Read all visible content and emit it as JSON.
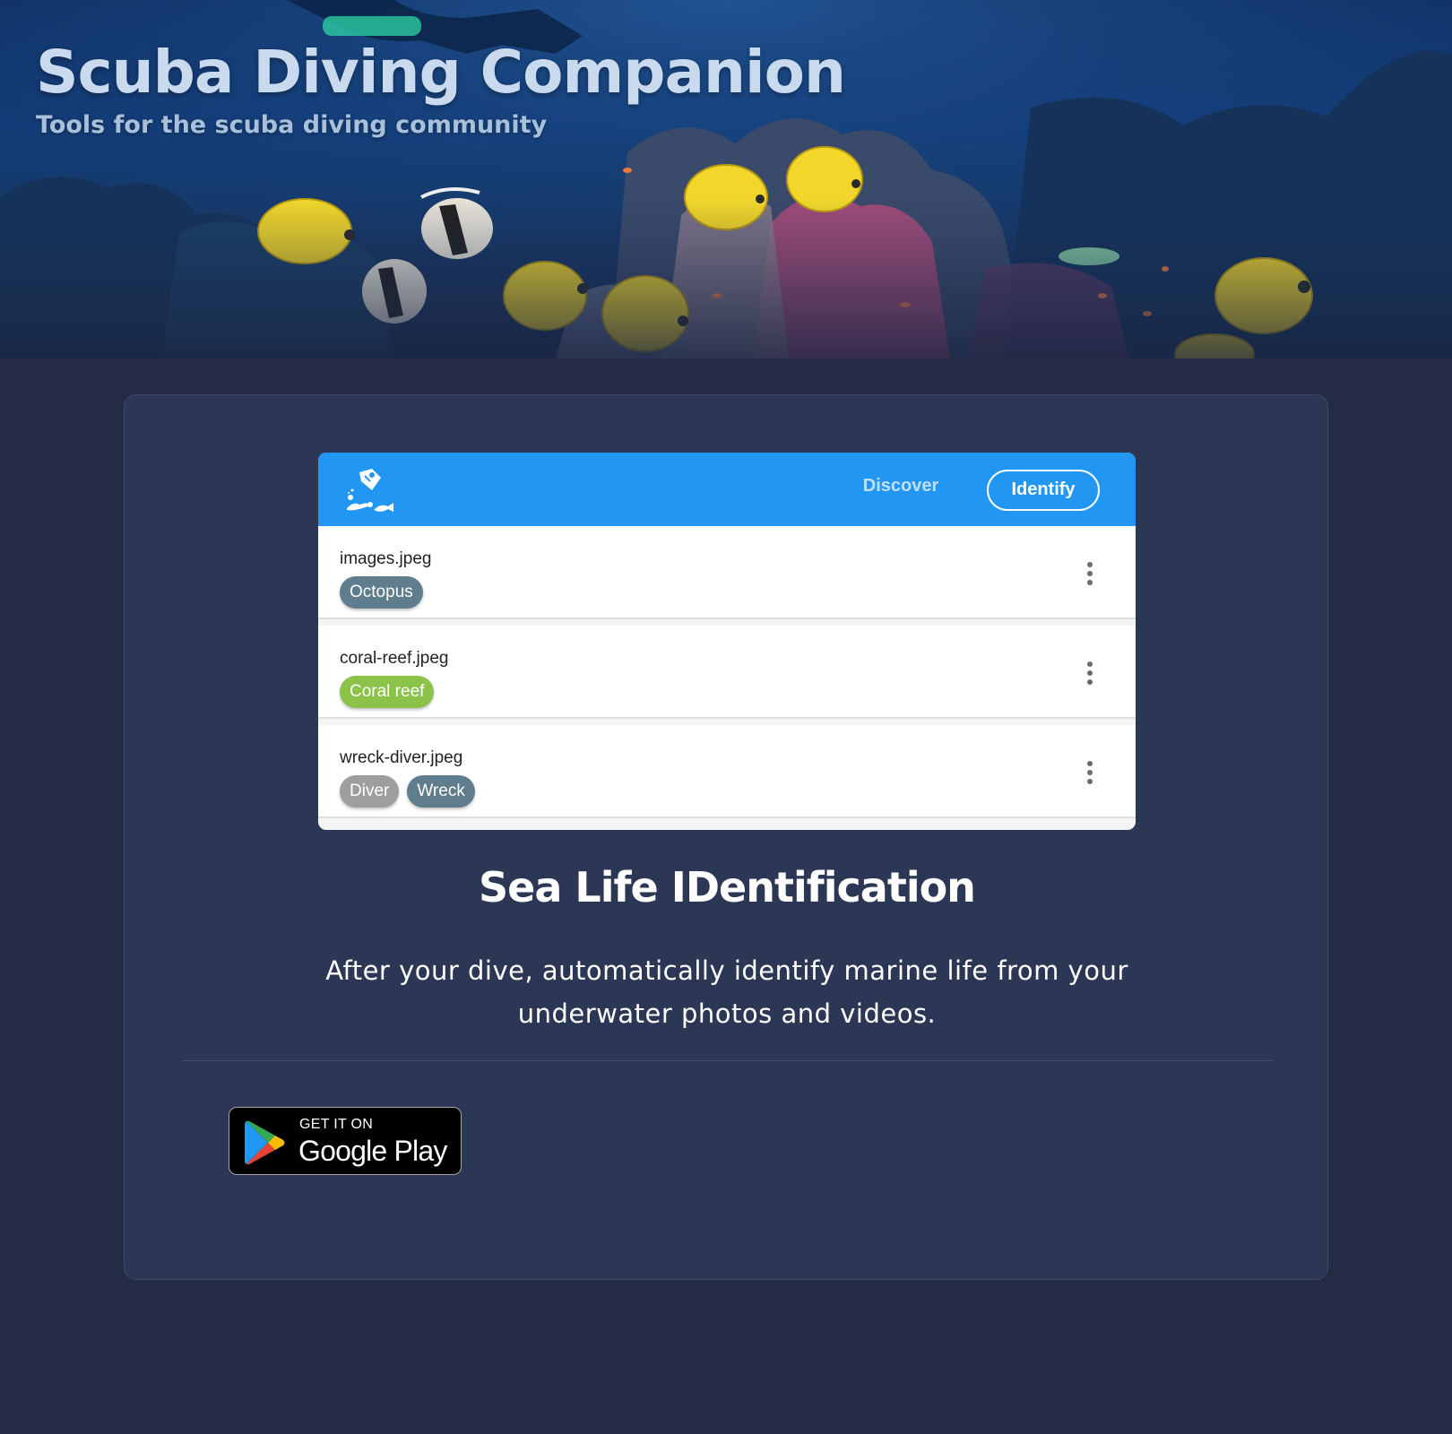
{
  "header": {
    "title": "Scuba Diving Companion",
    "subtitle": "Tools for the scuba diving community"
  },
  "app_preview": {
    "logo_icon": "diver-tag-icon",
    "nav": {
      "discover": "Discover",
      "identify": "Identify"
    },
    "files": [
      {
        "name": "images.jpeg",
        "tags": [
          "Octopus"
        ]
      },
      {
        "name": "coral-reef.jpeg",
        "tags": [
          "Coral reef"
        ]
      },
      {
        "name": "wreck-diver.jpeg",
        "tags": [
          "Diver",
          "Wreck"
        ]
      }
    ],
    "menu_icon": "more-vertical-icon"
  },
  "feature": {
    "title": "Sea Life IDentification",
    "description": "After your dive, automatically identify marine life from your underwater photos and videos."
  },
  "store_badge": {
    "top_text": "GET IT ON",
    "store_name": "Google Play",
    "icon": "google-play-icon"
  },
  "colors": {
    "page_background": "#242b45",
    "card_background": "#2c3655",
    "app_bar": "#2196f3",
    "tag_octopus": "#5f7d8c",
    "tag_coral_reef": "#8bc34a",
    "tag_diver": "#9e9e9e",
    "tag_wreck": "#5f7d8c"
  }
}
